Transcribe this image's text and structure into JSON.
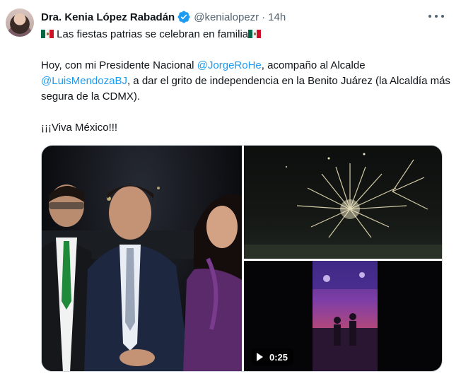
{
  "author": {
    "name": "Dra. Kenia López Rabadán",
    "handle": "@kenialopezr",
    "separator": "·",
    "time": "14h"
  },
  "tweet": {
    "line1": "Las fiestas patrias se celebran en familia",
    "p2_prefix": "Hoy, con mi Presidente Nacional ",
    "mention1": "@JorgeRoHe",
    "p2_mid": ", acompaño al Alcalde ",
    "mention2": "@LuisMendozaBJ",
    "p2_suffix": ", a dar el grito de independencia en la Benito Juárez (la Alcaldía más segura de la CDMX).",
    "p3": "¡¡¡Viva México!!!"
  },
  "media": {
    "video_duration": "0:25"
  },
  "colors": {
    "accent": "#1d9bf0",
    "text": "#0f1419",
    "muted": "#536471"
  },
  "icons": [
    "verified-badge-icon",
    "more-options-icon",
    "mexico-flag-icon",
    "play-icon"
  ]
}
